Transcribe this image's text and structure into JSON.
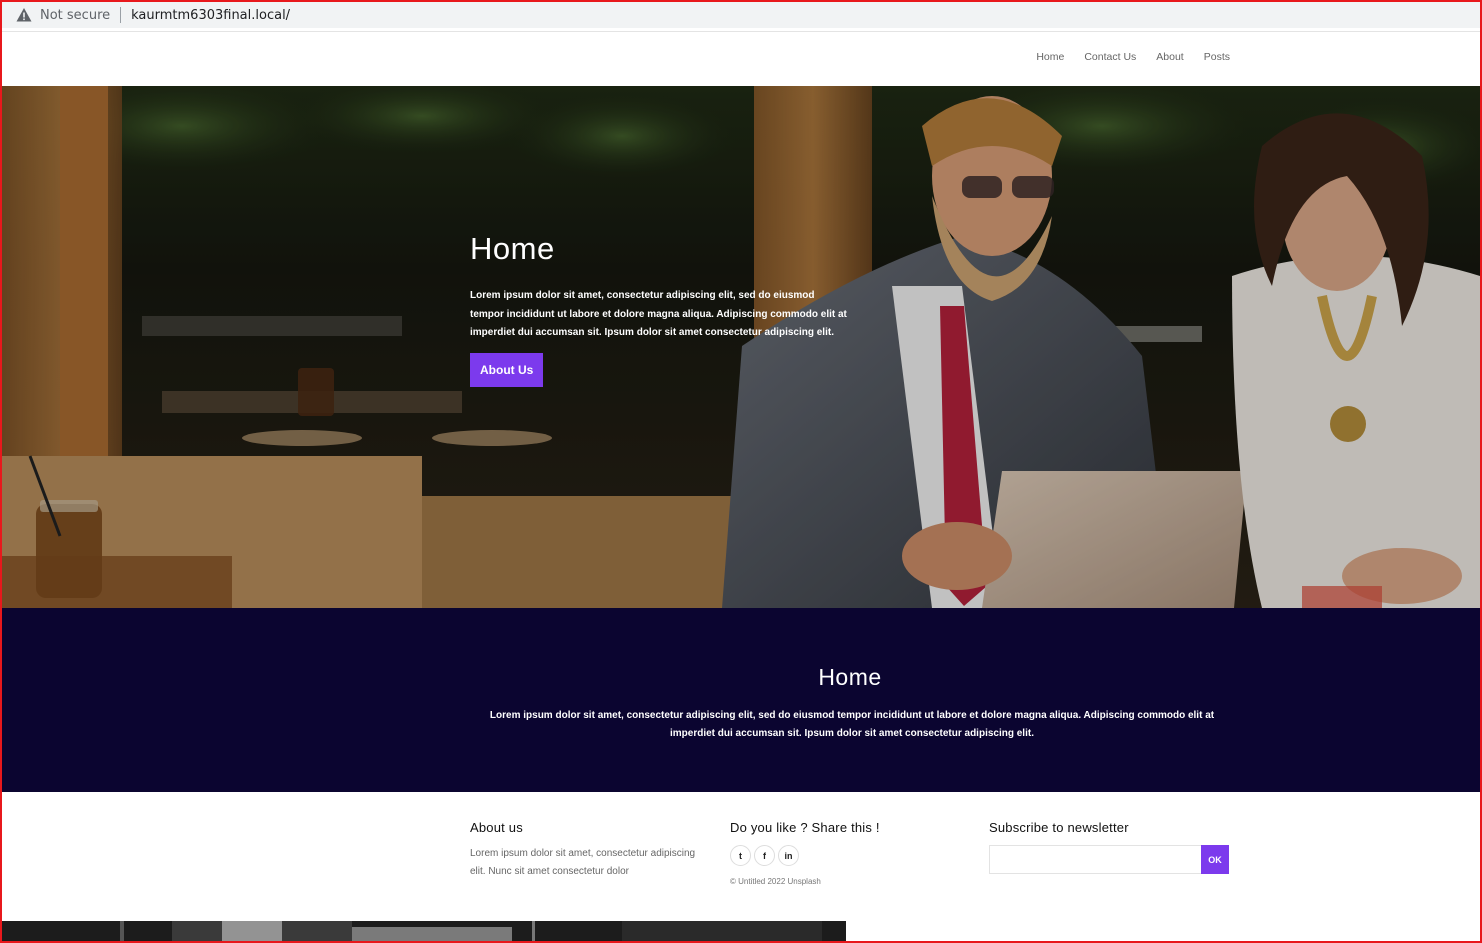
{
  "browser": {
    "security_label": "Not secure",
    "url": "kaurmtm6303final.local/"
  },
  "nav": {
    "items": [
      "Home",
      "Contact Us",
      "About",
      "Posts"
    ]
  },
  "hero": {
    "title": "Home",
    "text": "Lorem ipsum dolor sit amet, consectetur adipiscing elit, sed do eiusmod tempor incididunt ut labore et dolore magna aliqua. Adipiscing commodo elit at imperdiet dui accumsan sit. Ipsum dolor sit amet consectetur adipiscing elit.",
    "button_label": "About Us"
  },
  "band": {
    "title": "Home",
    "text": "Lorem ipsum dolor sit amet, consectetur adipiscing elit, sed do eiusmod tempor incididunt ut labore et dolore magna aliqua. Adipiscing commodo elit at imperdiet dui accumsan sit. Ipsum dolor sit amet consectetur adipiscing elit."
  },
  "footer": {
    "about_title": "About us",
    "about_text": "Lorem ipsum dolor sit amet, consectetur adipiscing elit. Nunc sit amet consectetur dolor",
    "share_title": "Do you like ? Share this !",
    "social": [
      {
        "icon": "twitter-icon",
        "glyph": "t"
      },
      {
        "icon": "facebook-icon",
        "glyph": "f"
      },
      {
        "icon": "linkedin-icon",
        "glyph": "in"
      }
    ],
    "copyright": "© Untitled 2022 Unsplash",
    "newsletter_title": "Subscribe to newsletter",
    "newsletter_button": "OK"
  },
  "colors": {
    "accent": "#7c3aed",
    "band_bg": "#0b0530",
    "frame": "#e8181c"
  }
}
